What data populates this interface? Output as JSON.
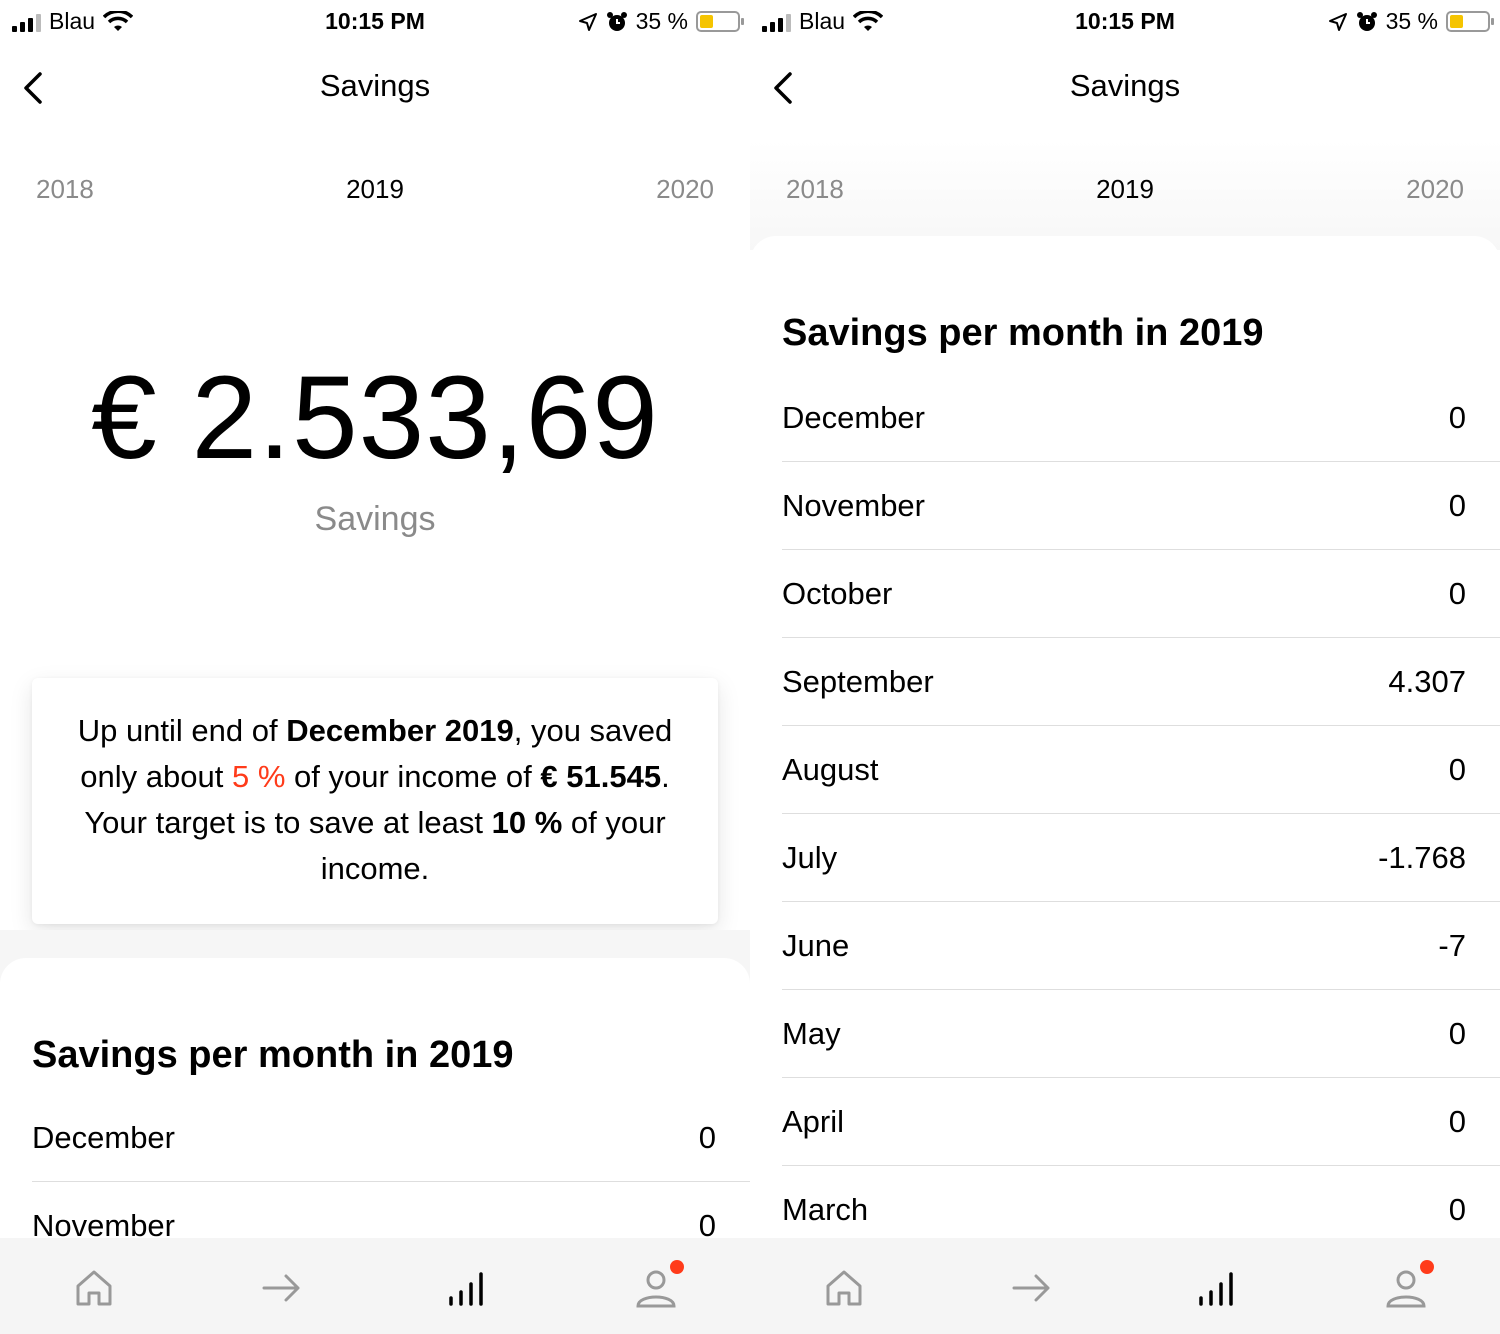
{
  "status_bar": {
    "carrier": "Blau",
    "time": "10:15 PM",
    "battery": "35 %",
    "battery_level": 0.35
  },
  "nav": {
    "title": "Savings"
  },
  "years": {
    "prev": "2018",
    "current": "2019",
    "next": "2020"
  },
  "summary": {
    "amount": "€ 2.533,69",
    "label": "Savings",
    "text_1": "Up until end of ",
    "bold_1": "December 2019",
    "text_2": ", you saved only about ",
    "highlight": "5 %",
    "text_3": " of your income of ",
    "bold_2": "€ 51.545",
    "text_4": ". Your target is to save at least ",
    "bold_3": "10 %",
    "text_5": " of your income."
  },
  "section_title": "Savings per month in 2019",
  "months": [
    {
      "name": "December",
      "value": "0"
    },
    {
      "name": "November",
      "value": "0"
    },
    {
      "name": "October",
      "value": "0"
    },
    {
      "name": "September",
      "value": "4.307"
    },
    {
      "name": "August",
      "value": "0"
    },
    {
      "name": "July",
      "value": "-1.768"
    },
    {
      "name": "June",
      "value": "-7"
    },
    {
      "name": "May",
      "value": "0"
    },
    {
      "name": "April",
      "value": "0"
    },
    {
      "name": "March",
      "value": "0"
    }
  ],
  "tab_bar": {
    "icons": [
      "home-icon",
      "arrow-right-icon",
      "bar-chart-icon",
      "profile-icon"
    ],
    "accent": "#ff3b1a"
  },
  "colors": {
    "accent": "#ff3b1a",
    "muted": "#8a8a8a"
  }
}
